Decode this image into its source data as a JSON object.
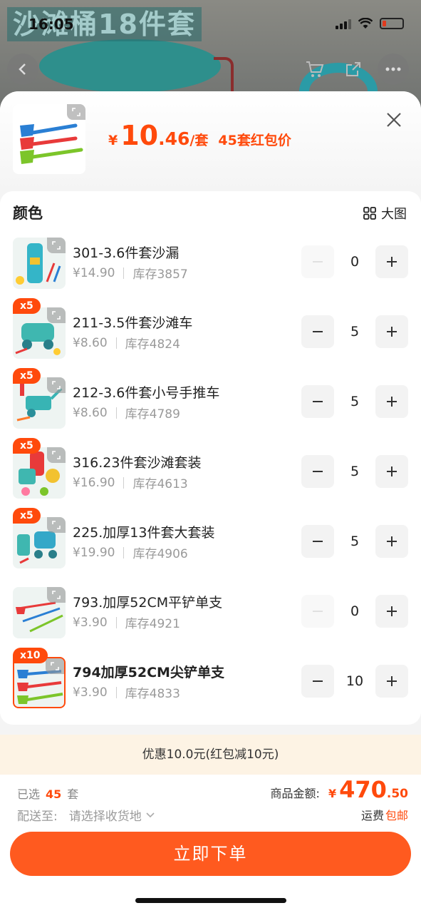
{
  "status": {
    "time": "16:05"
  },
  "background": {
    "title_text": "沙滩桶18件套"
  },
  "header": {
    "currency": "¥",
    "price_int": "10",
    "price_dec": ".46",
    "unit": "/套",
    "promo": "45套红包价"
  },
  "section": {
    "title": "颜色",
    "big_view": "大图"
  },
  "items": [
    {
      "name": "301-3.6件套沙漏",
      "price": "¥14.90",
      "stock": "库存3857",
      "qty": "0",
      "badge": "",
      "minus_disabled": true,
      "selected": false
    },
    {
      "name": "211-3.5件套沙滩车",
      "price": "¥8.60",
      "stock": "库存4824",
      "qty": "5",
      "badge": "x5",
      "minus_disabled": false,
      "selected": false
    },
    {
      "name": "212-3.6件套小号手推车",
      "price": "¥8.60",
      "stock": "库存4789",
      "qty": "5",
      "badge": "x5",
      "minus_disabled": false,
      "selected": false
    },
    {
      "name": "316.23件套沙滩套装",
      "price": "¥16.90",
      "stock": "库存4613",
      "qty": "5",
      "badge": "x5",
      "minus_disabled": false,
      "selected": false
    },
    {
      "name": "225.加厚13件套大套装",
      "price": "¥19.90",
      "stock": "库存4906",
      "qty": "5",
      "badge": "x5",
      "minus_disabled": false,
      "selected": false
    },
    {
      "name": "793.加厚52CM平铲单支",
      "price": "¥3.90",
      "stock": "库存4921",
      "qty": "0",
      "badge": "",
      "minus_disabled": true,
      "selected": false
    },
    {
      "name": "794加厚52CM尖铲单支",
      "price": "¥3.90",
      "stock": "库存4833",
      "qty": "10",
      "badge": "x10",
      "minus_disabled": false,
      "selected": true
    }
  ],
  "discount_text": "优惠10.0元(红包减10元)",
  "footer": {
    "selected_prefix": "已选",
    "selected_count": "45",
    "selected_suffix": "套",
    "ship_label": "配送至:",
    "ship_placeholder": "请选择收货地",
    "total_label": "商品金额:",
    "total_currency": "¥",
    "total_int": "470",
    "total_dec": ".50",
    "freight_label": "运费",
    "freight_value": "包邮",
    "order_button": "立即下单"
  },
  "colors": {
    "accent": "#ff4a0c",
    "button": "#ff5a1f",
    "discount_bg": "#fdf3e4"
  }
}
